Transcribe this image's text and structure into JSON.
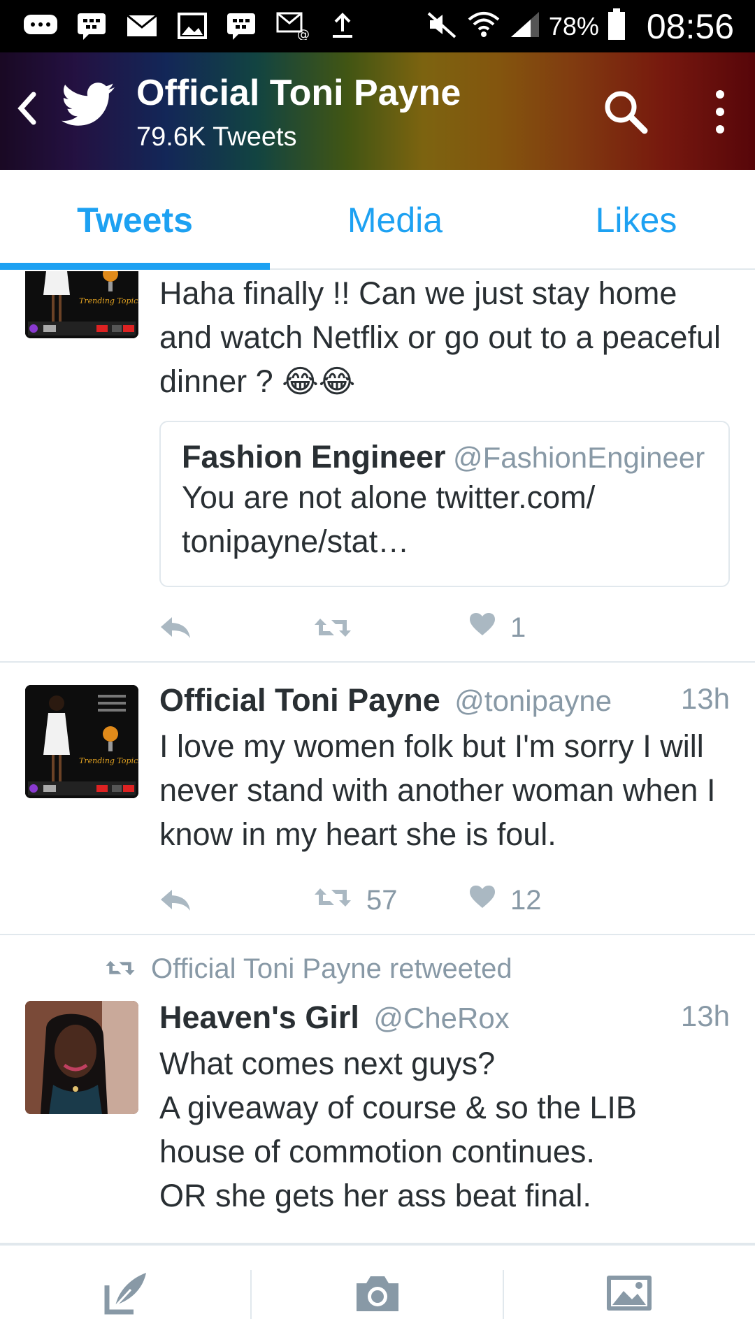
{
  "status_bar": {
    "battery_percent": "78%",
    "time": "08:56",
    "icons": [
      "chat-bubble-icon",
      "bbm-icon",
      "mail-icon",
      "image-icon",
      "bbm-icon",
      "email-at-icon",
      "upload-icon",
      "mute-icon",
      "wifi-icon",
      "signal-icon",
      "battery-icon"
    ]
  },
  "header": {
    "title": "Official Toni Payne",
    "subtitle": "79.6K Tweets"
  },
  "tabs": [
    {
      "label": "Tweets",
      "active": true
    },
    {
      "label": "Media",
      "active": false
    },
    {
      "label": "Likes",
      "active": false
    }
  ],
  "tweets": [
    {
      "text": "Haha finally !! Can we just stay home and watch Netflix or go out to a peaceful dinner ? 😂😂",
      "quote": {
        "name": "Fashion Engineer",
        "handle": "@FashionEngineer",
        "text": "You are not alone twitter.com/ tonipayne/stat…"
      },
      "likes": "1"
    },
    {
      "name": "Official Toni Payne",
      "handle": "@tonipayne",
      "time": "13h",
      "text": "I love my women folk but I'm sorry I will never stand with another woman when I know in my heart she is foul.",
      "retweets": "57",
      "likes": "12"
    },
    {
      "retweeted_by": "Official Toni Payne retweeted",
      "name": "Heaven's Girl",
      "handle": "@CheRox",
      "time": "13h",
      "text_lines": [
        "What comes next guys?",
        "A giveaway of course & so the LIB",
        "house of commotion continues.",
        "OR she gets her ass beat final."
      ]
    }
  ],
  "colors": {
    "accent": "#1da1f2",
    "text": "#292f33",
    "muted": "#8899a6",
    "divider": "#e1e8ed"
  }
}
